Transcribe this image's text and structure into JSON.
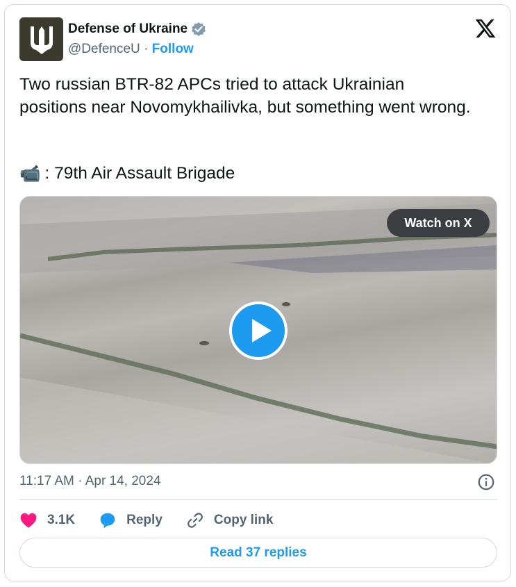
{
  "author": {
    "name": "Defense of Ukraine",
    "handle": "@DefenceU",
    "separator": "·",
    "follow_label": "Follow"
  },
  "tweet": {
    "text": "Two russian BTR-82 APCs tried to attack Ukrainian positions near Novomykhailivka, but something went wrong.",
    "credit_icon": "📹",
    "credit_text": ": 79th Air Assault Brigade"
  },
  "media": {
    "watch_label": "Watch on X",
    "type": "video"
  },
  "meta": {
    "timestamp": "11:17 AM · Apr 14, 2024"
  },
  "actions": {
    "likes": "3.1K",
    "reply_label": "Reply",
    "copy_label": "Copy link"
  },
  "replies_button": "Read 37 replies",
  "colors": {
    "accent": "#1d9bf0",
    "like": "#f91880",
    "muted": "#536471"
  }
}
